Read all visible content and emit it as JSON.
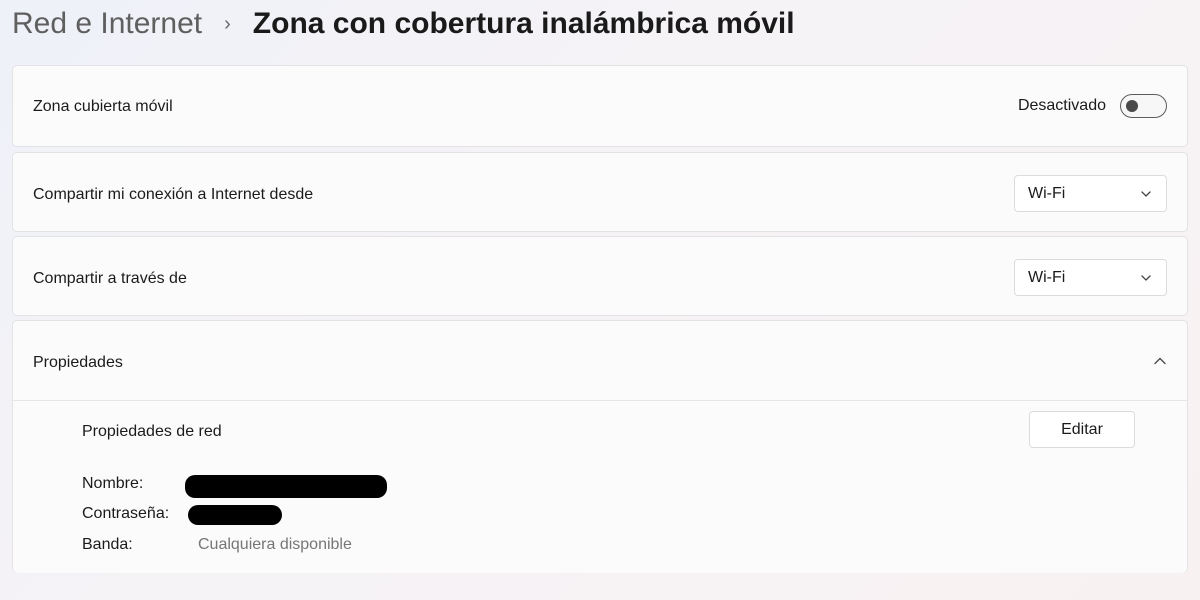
{
  "breadcrumb": {
    "parent": "Red e Internet",
    "separator": "›",
    "current": "Zona con cobertura inalámbrica móvil"
  },
  "hotspot": {
    "label": "Zona cubierta móvil",
    "toggle_state_text": "Desactivado",
    "toggle_on": false
  },
  "share_from": {
    "label": "Compartir mi conexión a Internet desde",
    "value": "Wi-Fi"
  },
  "share_via": {
    "label": "Compartir a través de",
    "value": "Wi-Fi"
  },
  "properties": {
    "header": "Propiedades",
    "expanded": true,
    "network_title": "Propiedades de red",
    "edit_label": "Editar",
    "name_label": "Nombre:",
    "name_value_redacted": true,
    "password_label": "Contraseña:",
    "password_value_redacted": true,
    "band_label": "Banda:",
    "band_value": "Cualquiera disponible"
  },
  "icons": {
    "breadcrumb_separator": "chevron-right-icon",
    "dropdown": "chevron-down-icon",
    "collapse": "chevron-up-icon"
  }
}
